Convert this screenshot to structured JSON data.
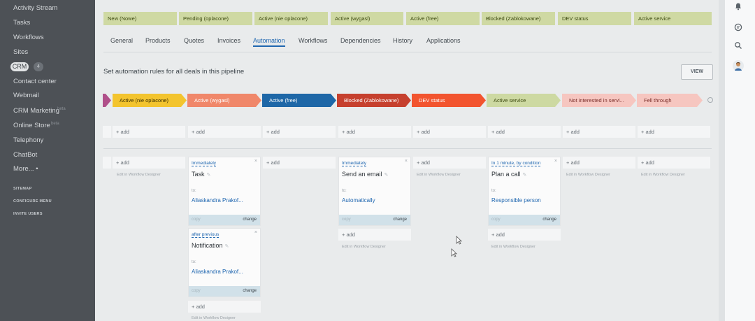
{
  "sidebar": {
    "items": [
      "Activity Stream",
      "Tasks",
      "Workflows",
      "Sites"
    ],
    "crm_label": "CRM",
    "crm_count": "4",
    "items2": [
      "Contact center",
      "Webmail",
      "CRM Marketing",
      "Online Store",
      "Telephony",
      "ChatBot",
      "More... •"
    ],
    "faint_beta": "beta",
    "faint_store": "beta",
    "sitemap": "SITEMAP",
    "configure_menu": "CONFIGURE MENU",
    "invite_users": "INVITE USERS"
  },
  "top_stages": [
    "New (Nowe)",
    "Pending (oplacone)",
    "Active (nie oplacone)",
    "Active (wygasl)",
    "Active (free)",
    "Blocked (Zablokowane)",
    "DEV status",
    "Active service"
  ],
  "tabs": [
    "General",
    "Products",
    "Quotes",
    "Invoices",
    "Automation",
    "Workflows",
    "Dependencies",
    "History",
    "Applications"
  ],
  "active_tab": "Automation",
  "heading": "Set automation rules for all deals in this pipeline",
  "view_button": "VIEW",
  "stages": [
    {
      "label": "Active (nie oplacone)",
      "color": "#f3c42e"
    },
    {
      "label": "Active (wygasl)",
      "color": "#f0876a"
    },
    {
      "label": "Active (free)",
      "color": "#1e67a7"
    },
    {
      "label": "Blocked (Zablokowane)",
      "color": "#c6402e"
    },
    {
      "label": "DEV status",
      "color": "#f2542f"
    },
    {
      "label": "Active service",
      "color": "#cdd9a2"
    },
    {
      "label": "Not interested in servi...",
      "color": "#f6c6c0"
    },
    {
      "label": "Fell through",
      "color": "#f6c6c0"
    }
  ],
  "add_label": "+ add",
  "edit_designer": "Edit in Workflow Designer",
  "cards": {
    "task": {
      "trigger": "Immediately",
      "title": "Task",
      "to": "to:",
      "recipient": "Aliaskandra Prakof...",
      "copy": "copy",
      "change": "change"
    },
    "notification": {
      "trigger": "after previous",
      "title": "Notification",
      "to": "to:",
      "recipient": "Aliaskandra Prakof...",
      "copy": "copy",
      "change": "change"
    },
    "email": {
      "trigger": "Immediately",
      "title": "Send an email",
      "to": "to:",
      "recipient": "Automatically",
      "copy": "copy",
      "change": "change"
    },
    "call": {
      "trigger": "In 1 minute, by condition",
      "title": "Plan a call",
      "to": "to:",
      "recipient": "Responsible person",
      "copy": "copy",
      "change": "change"
    }
  },
  "close_glyph": "×",
  "pencil_glyph": "✎"
}
